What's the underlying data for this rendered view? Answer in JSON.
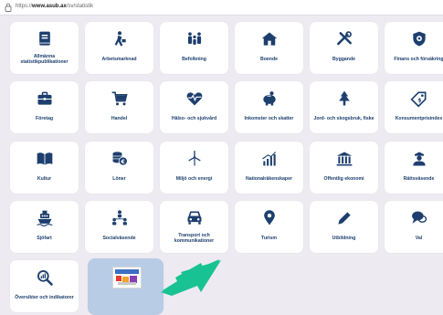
{
  "browser": {
    "url_prefix": "https://",
    "url_domain": "www.asub.ax",
    "url_path": "/sv/statistik"
  },
  "tiles": [
    {
      "label": "Allmänna statistikpublikationer",
      "icon": "book-icon"
    },
    {
      "label": "Arbetsmarknad",
      "icon": "worker-icon"
    },
    {
      "label": "Befolkning",
      "icon": "family-icon"
    },
    {
      "label": "Boende",
      "icon": "house-icon"
    },
    {
      "label": "Byggande",
      "icon": "tools-icon"
    },
    {
      "label": "Finans och försäkring",
      "icon": "shield-icon"
    },
    {
      "label": "Företag",
      "icon": "briefcase-icon"
    },
    {
      "label": "Handel",
      "icon": "cart-icon"
    },
    {
      "label": "Hälso- och sjukvård",
      "icon": "heartbeat-icon"
    },
    {
      "label": "Inkomster och skatter",
      "icon": "piggybank-icon"
    },
    {
      "label": "Jord- och skogsbruk, fiske",
      "icon": "tree-icon"
    },
    {
      "label": "Konsumentprisindex",
      "icon": "price-tag-icon"
    },
    {
      "label": "Kultur",
      "icon": "open-book-icon"
    },
    {
      "label": "Löner",
      "icon": "coins-icon"
    },
    {
      "label": "Miljö och energi",
      "icon": "wind-turbine-icon"
    },
    {
      "label": "Nationalräkenskaper",
      "icon": "bar-chart-icon"
    },
    {
      "label": "Offentlig ekonomi",
      "icon": "bank-icon"
    },
    {
      "label": "Rättsväsende",
      "icon": "police-icon"
    },
    {
      "label": "Sjöfart",
      "icon": "ship-icon"
    },
    {
      "label": "Socialväsende",
      "icon": "people-network-icon"
    },
    {
      "label": "Transport och kommunikationer",
      "icon": "car-icon"
    },
    {
      "label": "Turism",
      "icon": "map-pin-icon"
    },
    {
      "label": "Utbildning",
      "icon": "pencil-icon"
    },
    {
      "label": "Val",
      "icon": "speech-bubbles-icon"
    },
    {
      "label": "Översikter och indikatorer",
      "icon": "magnifier-chart-icon"
    },
    {
      "label": "",
      "icon": "thumbnail-image",
      "selected": true
    }
  ],
  "colors": {
    "icon": "#1d3f6e",
    "tile": "#ffffff",
    "selected_tile": "#b8cce6",
    "background": "#eeeaf1",
    "arrow": "#19c293"
  }
}
